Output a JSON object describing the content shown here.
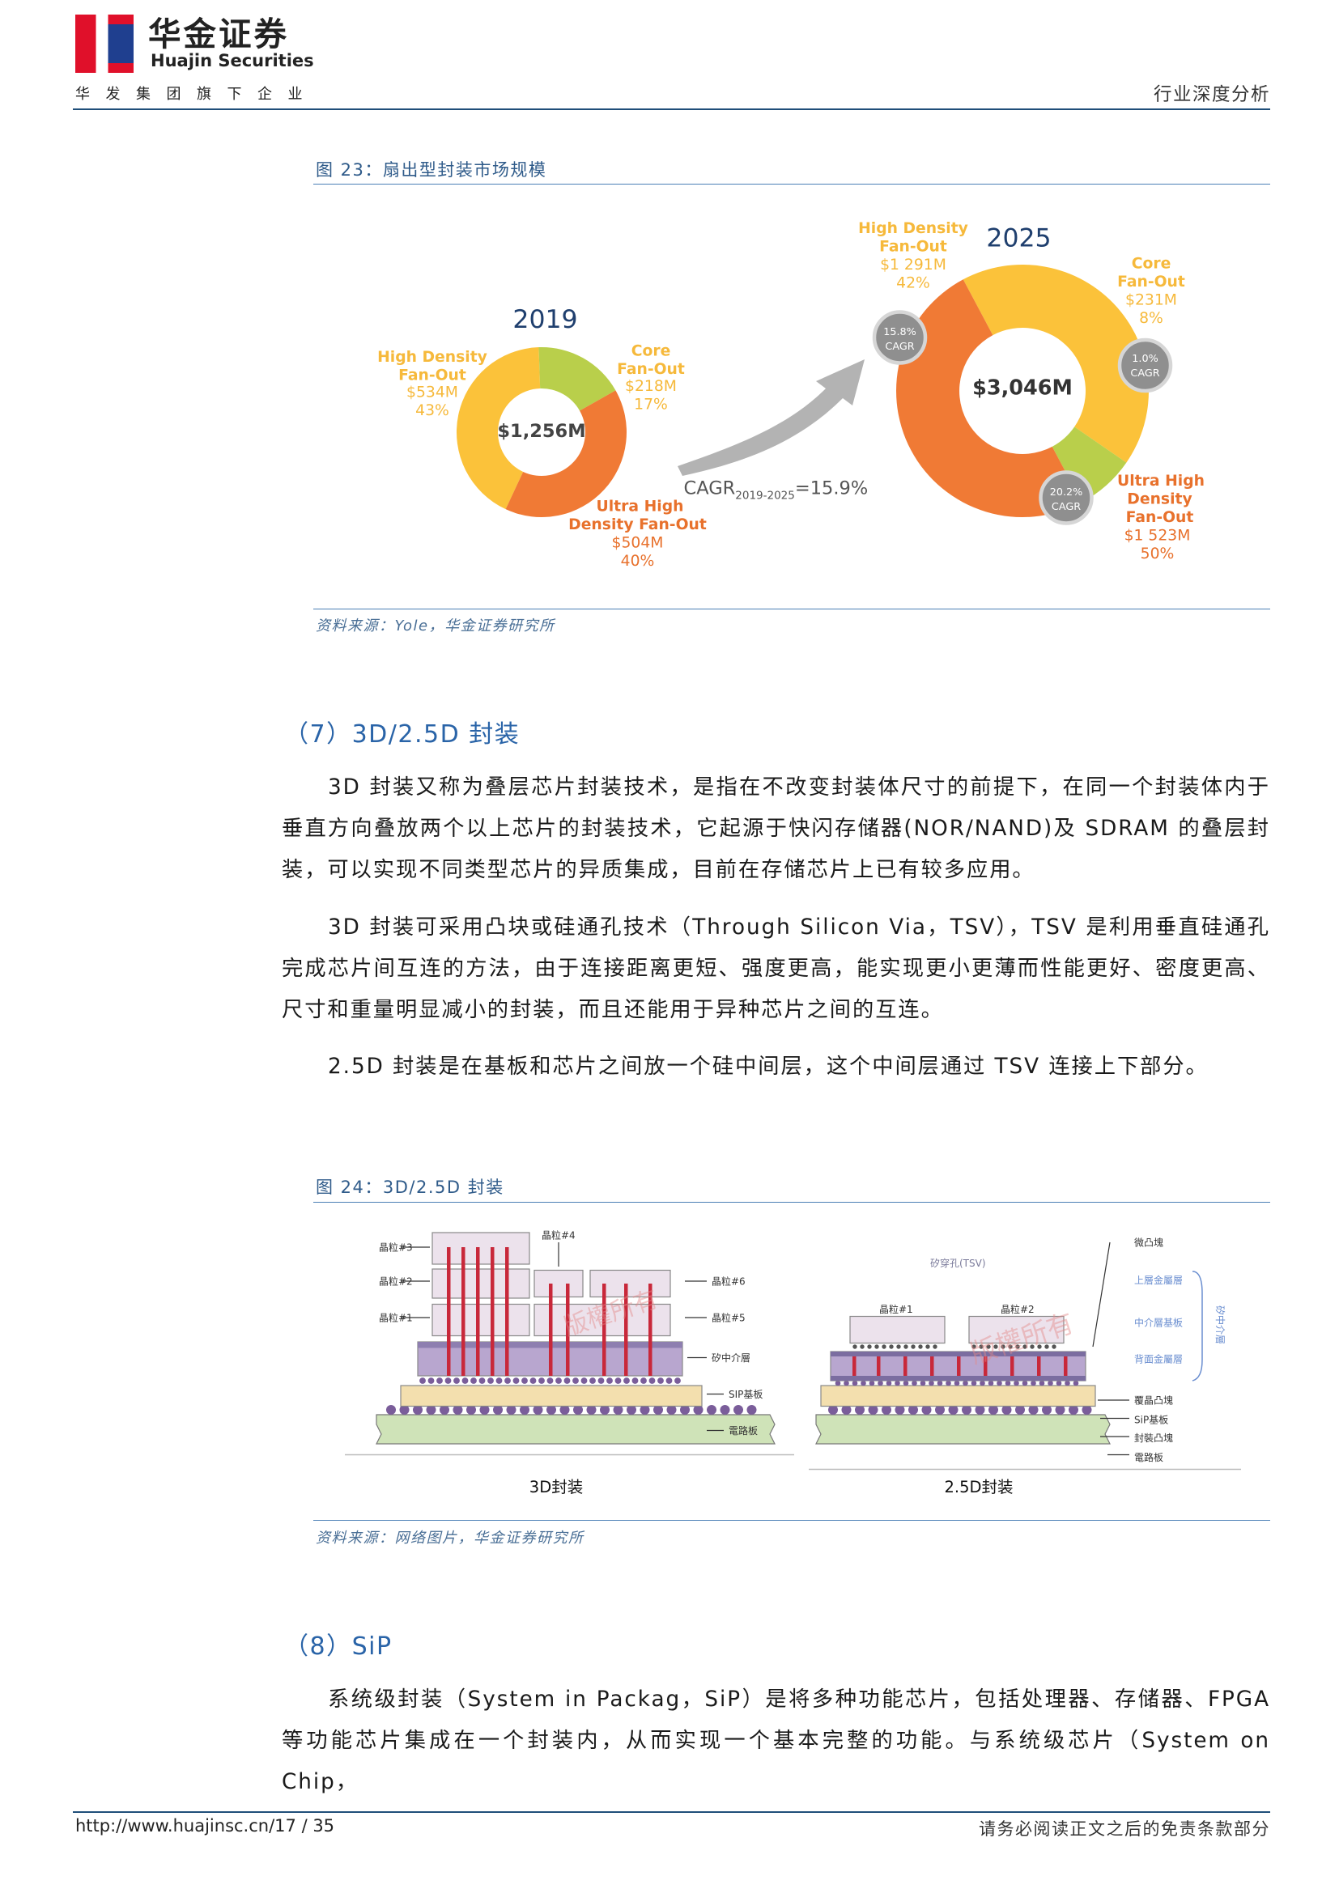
{
  "header": {
    "logo_cn": "华金证券",
    "logo_en": "Huajin Securities",
    "logo_sub": "华发集团旗下企业",
    "doc_type": "行业深度分析"
  },
  "figure23": {
    "title": "图 23：扇出型封装市场规模",
    "source": "资料来源：Yole，华金证券研究所",
    "chart": {
      "year_2019": "2019",
      "year_2025": "2025",
      "total_2019": "$1,256M",
      "total_2025": "$3,046M",
      "cagr_label": "CAGR",
      "cagr_sub": "2019-2025",
      "cagr_value": "=15.9%",
      "labels_2019": [
        {
          "l1": "High Density",
          "l2": "Fan-Out",
          "v": "$534M",
          "p": "43%"
        },
        {
          "l1": "Core",
          "l2": "Fan-Out",
          "v": "$218M",
          "p": "17%"
        },
        {
          "l1": "Ultra High",
          "l2": "Density Fan-Out",
          "v": "$504M",
          "p": "40%"
        }
      ],
      "labels_2025": [
        {
          "l1": "High Density",
          "l2": "Fan-Out",
          "v": "$1 291M",
          "p": "42%"
        },
        {
          "l1": "Core",
          "l2": "Fan-Out",
          "v": "$231M",
          "p": "8%"
        },
        {
          "l1": "Ultra High",
          "l2": "Density",
          "l3": "Fan-Out",
          "v": "$1 523M",
          "p": "50%"
        }
      ],
      "badges": [
        {
          "v": "15.8%",
          "c": "CAGR"
        },
        {
          "v": "1.0%",
          "c": "CAGR"
        },
        {
          "v": "20.2%",
          "c": "CAGR"
        }
      ]
    }
  },
  "chart_data": [
    {
      "type": "pie",
      "title": "2019",
      "categories": [
        "High Density Fan-Out",
        "Core Fan-Out",
        "Ultra High Density Fan-Out"
      ],
      "values": [
        534,
        218,
        504
      ],
      "percent": [
        43,
        17,
        40
      ],
      "total": 1256,
      "unit": "$M",
      "colors": [
        "#FBC23A",
        "#B9CF4B",
        "#F07A35"
      ]
    },
    {
      "type": "pie",
      "title": "2025",
      "categories": [
        "High Density Fan-Out",
        "Core Fan-Out",
        "Ultra High Density Fan-Out"
      ],
      "values": [
        1291,
        231,
        1523
      ],
      "percent": [
        42,
        8,
        50
      ],
      "total": 3046,
      "unit": "$M",
      "colors": [
        "#FBC23A",
        "#B9CF4B",
        "#F07A35"
      ],
      "cagr": [
        15.8,
        1.0,
        20.2
      ]
    }
  ],
  "section7": {
    "title": "（7）3D/2.5D 封装",
    "p1": "3D 封装又称为叠层芯片封装技术，是指在不改变封装体尺寸的前提下，在同一个封装体内于垂直方向叠放两个以上芯片的封装技术，它起源于快闪存储器(NOR/NAND)及 SDRAM 的叠层封装，可以实现不同类型芯片的异质集成，目前在存储芯片上已有较多应用。",
    "p2": "3D 封装可采用凸块或硅通孔技术（Through Silicon Via，TSV），TSV 是利用垂直硅通孔完成芯片间互连的方法，由于连接距离更短、强度更高，能实现更小更薄而性能更好、密度更高、尺寸和重量明显减小的封装，而且还能用于异种芯片之间的互连。",
    "p3": "2.5D 封装是在基板和芯片之间放一个硅中间层，这个中间层通过 TSV 连接上下部分。"
  },
  "figure24": {
    "title": "图 24：3D/2.5D 封装",
    "source": "资料来源：网络图片，华金证券研究所",
    "caption_3d": "3D封装",
    "caption_25d": "2.5D封装",
    "labels_3d": [
      "晶粒#3",
      "晶粒#2",
      "晶粒#1",
      "晶粒#4",
      "晶粒#6",
      "晶粒#5",
      "矽中介層",
      "SIP基板",
      "電路板"
    ],
    "labels_25d": [
      "微凸塊",
      "矽穿孔(TSV)",
      "上層金屬層",
      "中介層基板",
      "背面金屬層",
      "晶粒#1",
      "晶粒#2",
      "覆晶凸塊",
      "SiP基板",
      "封裝凸塊",
      "電路板",
      "矽中介層"
    ],
    "watermark": "版權所有"
  },
  "section8": {
    "title": "（8）SiP",
    "p1": "系统级封装（System in Packag，SiP）是将多种功能芯片，包括处理器、存储器、FPGA 等功能芯片集成在一个封装内，从而实现一个基本完整的功能。与系统级芯片（System on Chip，"
  },
  "footer": {
    "url": "http://www.huajinsc.cn/",
    "page": "17 / 35",
    "disclaimer": "请务必阅读正文之后的免责条款部分"
  }
}
